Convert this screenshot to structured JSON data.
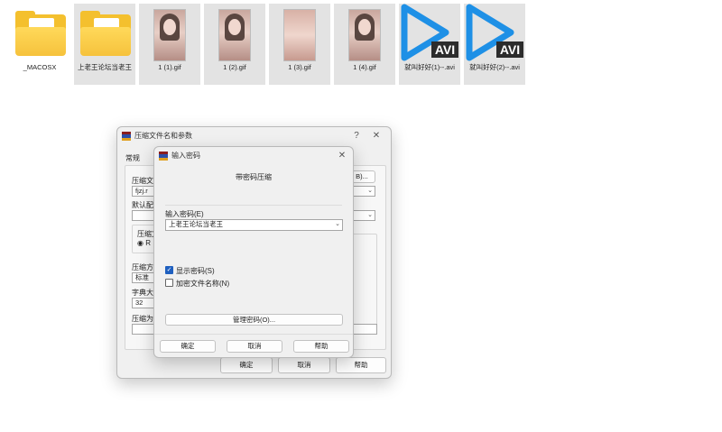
{
  "files": [
    {
      "name": "_MACOSX",
      "type": "folder",
      "selected": false
    },
    {
      "name": "上老王论坛当老王",
      "type": "folder",
      "selected": true
    },
    {
      "name": "1 (1).gif",
      "type": "image",
      "selected": true
    },
    {
      "name": "1 (2).gif",
      "type": "image",
      "selected": true
    },
    {
      "name": "1 (3).gif",
      "type": "image",
      "selected": true
    },
    {
      "name": "1 (4).gif",
      "type": "image",
      "selected": true
    },
    {
      "name": "就叫好好(1)--.avi",
      "type": "video",
      "badge": "AVI",
      "selected": true
    },
    {
      "name": "就叫好好(2)--.avi",
      "type": "video",
      "badge": "AVI",
      "selected": true
    }
  ],
  "back_dialog": {
    "title": "压缩文件名和参数",
    "help_glyph": "?",
    "close_glyph": "✕",
    "tab_general": "常规",
    "archive_name_label": "压缩文",
    "archive_name_value": "fjzj.r",
    "browse_label": "B)...",
    "profile_label": "默认配",
    "format_label": "压缩文",
    "format_option": "R",
    "method_label": "压缩方",
    "method_value": "标准",
    "dict_label": "字典大",
    "dict_value": "32",
    "split_label": "压缩为",
    "ok_label": "确定",
    "cancel_label": "取消",
    "help_label": "帮助"
  },
  "password_dialog": {
    "title": "输入密码",
    "close_glyph": "✕",
    "heading": "带密码压缩",
    "password_label": "输入密码(E)",
    "password_value": "上老王论坛当老王",
    "show_password_label": "显示密码(S)",
    "show_password_checked": true,
    "encrypt_names_label": "加密文件名称(N)",
    "encrypt_names_checked": false,
    "manage_label": "管理密码(O)...",
    "ok_label": "确定",
    "cancel_label": "取消",
    "help_label": "帮助"
  },
  "colors": {
    "folder": "#f4c02e",
    "avi_blue": "#1e90e6",
    "checkbox_accent": "#1f5fbf"
  }
}
